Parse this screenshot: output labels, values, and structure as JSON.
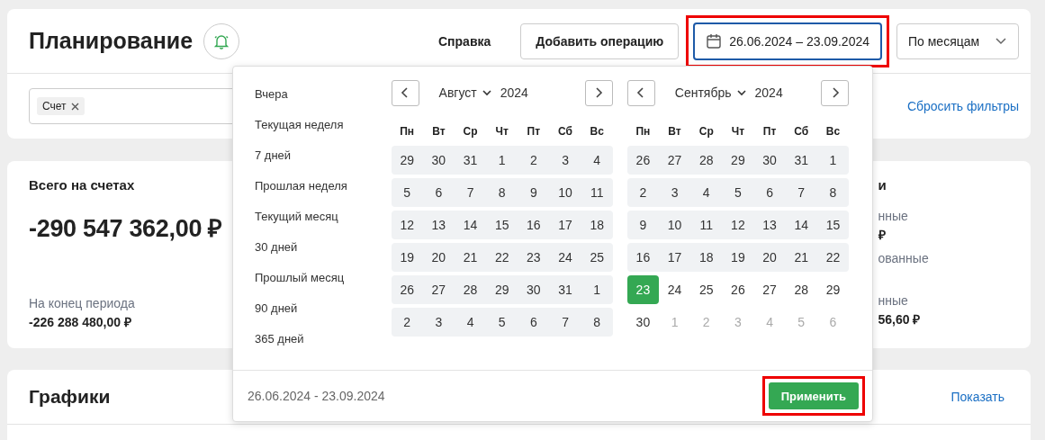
{
  "header": {
    "title": "Планирование",
    "help_link": "Справка",
    "add_button": "Добавить операцию",
    "date_range": {
      "value": "26.06.2024 – 23.09.2024",
      "highlighted": true
    },
    "period_select": "По месяцам"
  },
  "filters": {
    "chips": [
      {
        "label": "Счет"
      }
    ],
    "reset_link": "Сбросить фильтры"
  },
  "total_card": {
    "title": "Всего на счетах",
    "amount": "-290 547 362,00 ₽",
    "end_label": "На конец периода",
    "end_value": "-226 288 480,00 ₽"
  },
  "second_card": {
    "title": "и",
    "groups": [
      {
        "label": "нные",
        "value": "₽"
      },
      {
        "label": "ованные"
      },
      {
        "label": "нные",
        "value": "56,60 ₽"
      }
    ]
  },
  "charts_card": {
    "title": "Графики",
    "show_link": "Показать"
  },
  "date_popup": {
    "presets": [
      "Вчера",
      "Текущая неделя",
      "7 дней",
      "Прошлая неделя",
      "Текущий месяц",
      "30 дней",
      "Прошлый месяц",
      "90 дней",
      "365 дней"
    ],
    "calendars": [
      {
        "month": "Август",
        "year": "2024",
        "weekdays": [
          "Пн",
          "Вт",
          "Ср",
          "Чт",
          "Пт",
          "Сб",
          "Вс"
        ],
        "weeks": [
          [
            {
              "day": "29",
              "kind": "range"
            },
            {
              "day": "30",
              "kind": "range"
            },
            {
              "day": "31",
              "kind": "range"
            },
            {
              "day": "1",
              "kind": "range"
            },
            {
              "day": "2",
              "kind": "range"
            },
            {
              "day": "3",
              "kind": "range"
            },
            {
              "day": "4",
              "kind": "range"
            }
          ],
          [
            {
              "day": "5",
              "kind": "range"
            },
            {
              "day": "6",
              "kind": "range"
            },
            {
              "day": "7",
              "kind": "range"
            },
            {
              "day": "8",
              "kind": "range"
            },
            {
              "day": "9",
              "kind": "range"
            },
            {
              "day": "10",
              "kind": "range"
            },
            {
              "day": "11",
              "kind": "range"
            }
          ],
          [
            {
              "day": "12",
              "kind": "range"
            },
            {
              "day": "13",
              "kind": "range"
            },
            {
              "day": "14",
              "kind": "range"
            },
            {
              "day": "15",
              "kind": "range"
            },
            {
              "day": "16",
              "kind": "range"
            },
            {
              "day": "17",
              "kind": "range"
            },
            {
              "day": "18",
              "kind": "range"
            }
          ],
          [
            {
              "day": "19",
              "kind": "range"
            },
            {
              "day": "20",
              "kind": "range"
            },
            {
              "day": "21",
              "kind": "range"
            },
            {
              "day": "22",
              "kind": "range"
            },
            {
              "day": "23",
              "kind": "range"
            },
            {
              "day": "24",
              "kind": "range"
            },
            {
              "day": "25",
              "kind": "range"
            }
          ],
          [
            {
              "day": "26",
              "kind": "range"
            },
            {
              "day": "27",
              "kind": "range"
            },
            {
              "day": "28",
              "kind": "range"
            },
            {
              "day": "29",
              "kind": "range"
            },
            {
              "day": "30",
              "kind": "range"
            },
            {
              "day": "31",
              "kind": "range"
            },
            {
              "day": "1",
              "kind": "range"
            }
          ],
          [
            {
              "day": "2",
              "kind": "range"
            },
            {
              "day": "3",
              "kind": "range"
            },
            {
              "day": "4",
              "kind": "range"
            },
            {
              "day": "5",
              "kind": "range"
            },
            {
              "day": "6",
              "kind": "range"
            },
            {
              "day": "7",
              "kind": "range"
            },
            {
              "day": "8",
              "kind": "range"
            }
          ]
        ]
      },
      {
        "month": "Сентябрь",
        "year": "2024",
        "weekdays": [
          "Пн",
          "Вт",
          "Ср",
          "Чт",
          "Пт",
          "Сб",
          "Вс"
        ],
        "weeks": [
          [
            {
              "day": "26",
              "kind": "range"
            },
            {
              "day": "27",
              "kind": "range"
            },
            {
              "day": "28",
              "kind": "range"
            },
            {
              "day": "29",
              "kind": "range"
            },
            {
              "day": "30",
              "kind": "range"
            },
            {
              "day": "31",
              "kind": "range"
            },
            {
              "day": "1",
              "kind": "range"
            }
          ],
          [
            {
              "day": "2",
              "kind": "range"
            },
            {
              "day": "3",
              "kind": "range"
            },
            {
              "day": "4",
              "kind": "range"
            },
            {
              "day": "5",
              "kind": "range"
            },
            {
              "day": "6",
              "kind": "range"
            },
            {
              "day": "7",
              "kind": "range"
            },
            {
              "day": "8",
              "kind": "range"
            }
          ],
          [
            {
              "day": "9",
              "kind": "range"
            },
            {
              "day": "10",
              "kind": "range"
            },
            {
              "day": "11",
              "kind": "range"
            },
            {
              "day": "12",
              "kind": "range"
            },
            {
              "day": "13",
              "kind": "range"
            },
            {
              "day": "14",
              "kind": "range"
            },
            {
              "day": "15",
              "kind": "range"
            }
          ],
          [
            {
              "day": "16",
              "kind": "range"
            },
            {
              "day": "17",
              "kind": "range"
            },
            {
              "day": "18",
              "kind": "range"
            },
            {
              "day": "19",
              "kind": "range"
            },
            {
              "day": "20",
              "kind": "range"
            },
            {
              "day": "21",
              "kind": "range"
            },
            {
              "day": "22",
              "kind": "range"
            }
          ],
          [
            {
              "day": "23",
              "kind": "end"
            },
            {
              "day": "24",
              "kind": "plain"
            },
            {
              "day": "25",
              "kind": "plain"
            },
            {
              "day": "26",
              "kind": "plain"
            },
            {
              "day": "27",
              "kind": "plain"
            },
            {
              "day": "28",
              "kind": "plain"
            },
            {
              "day": "29",
              "kind": "plain"
            }
          ],
          [
            {
              "day": "30",
              "kind": "plain"
            },
            {
              "day": "1",
              "kind": "muted"
            },
            {
              "day": "2",
              "kind": "muted"
            },
            {
              "day": "3",
              "kind": "muted"
            },
            {
              "day": "4",
              "kind": "muted"
            },
            {
              "day": "5",
              "kind": "muted"
            },
            {
              "day": "6",
              "kind": "muted"
            }
          ]
        ]
      }
    ],
    "footer_range": "26.06.2024 - 23.09.2024",
    "apply_button": {
      "label": "Применить",
      "highlighted": true
    }
  }
}
